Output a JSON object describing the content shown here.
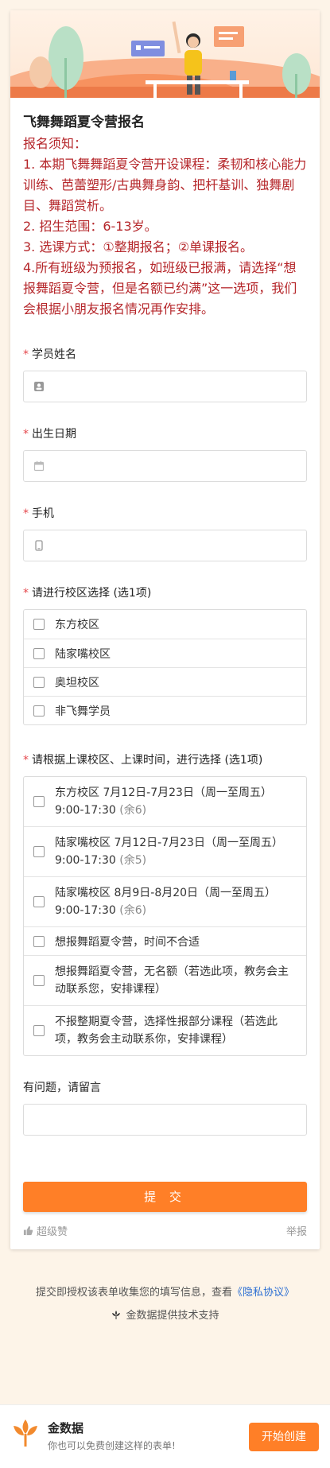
{
  "form": {
    "title": "飞舞舞蹈夏令营报名",
    "notice_lines": [
      "报名须知：",
      "1. 本期飞舞舞蹈夏令营开设课程：柔韧和核心能力训练、芭蕾塑形/古典舞身韵、把杆基训、独舞剧目、舞蹈赏析。",
      "2. 招生范围：6-13岁。",
      "3. 选课方式：①整期报名；②单课报名。",
      "4.所有班级为预报名，如班级已报满，请选择“想报舞蹈夏令营，但是名额已约满”这一选项，我们会根据小朋友报名情况再作安排。"
    ],
    "fields": {
      "name_label": "学员姓名",
      "birth_label": "出生日期",
      "phone_label": "手机",
      "campus_label": "请进行校区选择 (选1项)",
      "campus_options": [
        "东方校区",
        "陆家嘴校区",
        "奥坦校区",
        "非飞舞学员"
      ],
      "session_label": "请根据上课校区、上课时间，进行选择 (选1项)",
      "session_options": [
        {
          "line1": "东方校区 7月12日-7月23日（周一至周五）",
          "line2": "9:00-17:30",
          "remain": "(余6)"
        },
        {
          "line1": "陆家嘴校区 7月12日-7月23日（周一至周五）",
          "line2": "9:00-17:30",
          "remain": "(余5)"
        },
        {
          "line1": "陆家嘴校区 8月9日-8月20日（周一至周五）",
          "line2": "9:00-17:30",
          "remain": "(余6)"
        },
        {
          "line1": "想报舞蹈夏令营，时间不合适",
          "line2": "",
          "remain": ""
        },
        {
          "line1": "想报舞蹈夏令营，无名额（若选此项，教务会主",
          "line2": "动联系您，安排课程）",
          "remain": ""
        },
        {
          "line1": "不报整期夏令营，选择性报部分课程（若选此",
          "line2": "项，教务会主动联系你，安排课程）",
          "remain": ""
        }
      ],
      "message_label": "有问题，请留言"
    },
    "submit_label": "提 交",
    "like_label": "超级赞",
    "report_label": "举报"
  },
  "footer": {
    "consent_prefix": "提交即授权该表单收集您的填写信息，查看",
    "consent_link": "《隐私协议》",
    "powered": "金数据提供技术支持"
  },
  "bottom_bar": {
    "brand": "金数据",
    "tagline": "你也可以免费创建这样的表单!",
    "start_button": "开始创建"
  },
  "colors": {
    "accent": "#ff7f27",
    "notice": "#b5262a",
    "required": "#e5484d",
    "page_bg": "#fdf4e8"
  }
}
